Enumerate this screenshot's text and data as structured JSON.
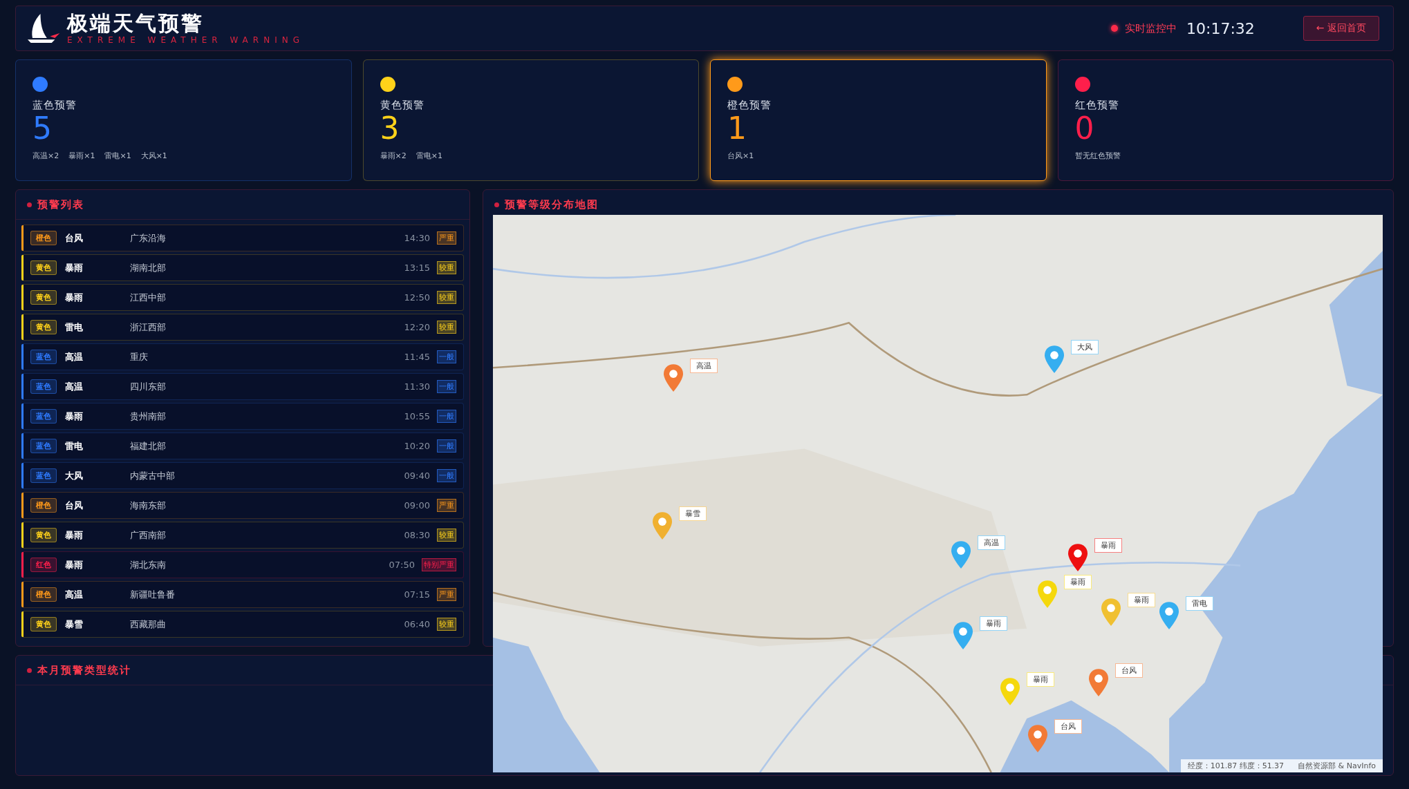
{
  "header": {
    "title": "极端天气预警",
    "subtitle": "EXTREME WEATHER WARNING",
    "live_status": "实时监控中",
    "time": "10:17:32",
    "back_button": "← 返回首页"
  },
  "summary_cards": [
    {
      "color": "#2f7bff",
      "title": "蓝色预警",
      "count": "5",
      "details": [
        "高温×2",
        "暴雨×1",
        "雷电×1",
        "大风×1"
      ],
      "selected": false
    },
    {
      "color": "#ffd21a",
      "title": "黄色预警",
      "count": "3",
      "details": [
        "暴雨×2",
        "雷电×1"
      ],
      "selected": false
    },
    {
      "color": "#ff9a1a",
      "title": "橙色预警",
      "count": "1",
      "details": [
        "台风×1"
      ],
      "selected": true
    },
    {
      "color": "#ff1f4b",
      "title": "红色预警",
      "count": "0",
      "details": [
        "暂无红色预警"
      ],
      "selected": false
    }
  ],
  "warning_list": {
    "title": "预警列表",
    "rows": [
      {
        "color": "#ff9a1a",
        "grade_label": "橙色",
        "type": "台风",
        "region": "广东沿海",
        "time": "14:30",
        "severity": "严重"
      },
      {
        "color": "#ffd21a",
        "grade_label": "黄色",
        "type": "暴雨",
        "region": "湖南北部",
        "time": "13:15",
        "severity": "较重"
      },
      {
        "color": "#ffd21a",
        "grade_label": "黄色",
        "type": "暴雨",
        "region": "江西中部",
        "time": "12:50",
        "severity": "较重"
      },
      {
        "color": "#ffd21a",
        "grade_label": "黄色",
        "type": "雷电",
        "region": "浙江西部",
        "time": "12:20",
        "severity": "较重"
      },
      {
        "color": "#2f7bff",
        "grade_label": "蓝色",
        "type": "高温",
        "region": "重庆",
        "time": "11:45",
        "severity": "一般"
      },
      {
        "color": "#2f7bff",
        "grade_label": "蓝色",
        "type": "高温",
        "region": "四川东部",
        "time": "11:30",
        "severity": "一般"
      },
      {
        "color": "#2f7bff",
        "grade_label": "蓝色",
        "type": "暴雨",
        "region": "贵州南部",
        "time": "10:55",
        "severity": "一般"
      },
      {
        "color": "#2f7bff",
        "grade_label": "蓝色",
        "type": "雷电",
        "region": "福建北部",
        "time": "10:20",
        "severity": "一般"
      },
      {
        "color": "#2f7bff",
        "grade_label": "蓝色",
        "type": "大风",
        "region": "内蒙古中部",
        "time": "09:40",
        "severity": "一般"
      },
      {
        "color": "#ff9a1a",
        "grade_label": "橙色",
        "type": "台风",
        "region": "海南东部",
        "time": "09:00",
        "severity": "严重"
      },
      {
        "color": "#ffd21a",
        "grade_label": "黄色",
        "type": "暴雨",
        "region": "广西南部",
        "time": "08:30",
        "severity": "较重"
      },
      {
        "color": "#ff1f4b",
        "grade_label": "红色",
        "type": "暴雨",
        "region": "湖北东南",
        "time": "07:50",
        "severity": "特别严重"
      },
      {
        "color": "#ff9a1a",
        "grade_label": "橙色",
        "type": "高温",
        "region": "新疆吐鲁番",
        "time": "07:15",
        "severity": "严重"
      },
      {
        "color": "#ffd21a",
        "grade_label": "黄色",
        "type": "暴雪",
        "region": "西藏那曲",
        "time": "06:40",
        "severity": "较重"
      }
    ]
  },
  "map": {
    "title": "预警等级分布地图",
    "kind": "picture",
    "markers": [
      {
        "color": "#f27a36",
        "label": "高温"
      },
      {
        "color": "#35aef0",
        "label": "大风"
      },
      {
        "color": "#f0b030",
        "label": "暴雪"
      },
      {
        "color": "#35aef0",
        "label": "高温"
      },
      {
        "color": "#ee1010",
        "label": "暴雨"
      },
      {
        "color": "#f5d80c",
        "label": "暴雨"
      },
      {
        "color": "#f0c030",
        "label": "暴雨"
      },
      {
        "color": "#35aef0",
        "label": "雷电"
      },
      {
        "color": "#35aef0",
        "label": "暴雨"
      },
      {
        "color": "#f5d80c",
        "label": "暴雨"
      },
      {
        "color": "#f27a36",
        "label": "台风"
      },
      {
        "color": "#f27a36",
        "label": "台风"
      }
    ],
    "coordinates": "经度：101.87 纬度：51.37",
    "attribution": "自然资源部 & NavInfo"
  },
  "stats_panel": {
    "title": "本月预警类型统计"
  }
}
